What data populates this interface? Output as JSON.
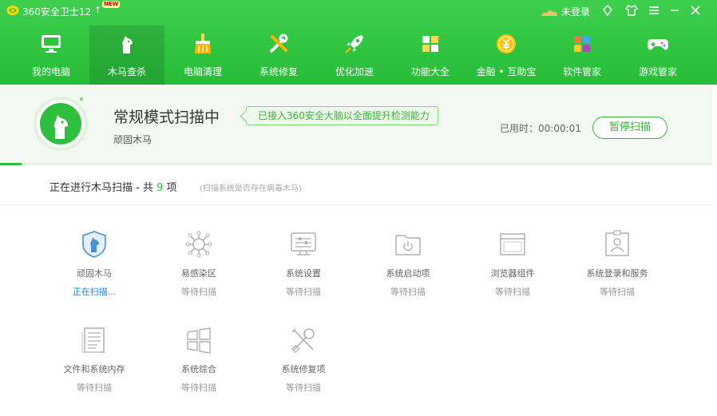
{
  "titlebar": {
    "app_title": "360安全卫士12",
    "new_badge": "NEW",
    "up_arrow": "↑",
    "login_label": "未登录"
  },
  "nav": [
    {
      "label": "我的电脑",
      "icon": "monitor-icon",
      "active": false
    },
    {
      "label": "木马查杀",
      "icon": "horse-icon",
      "active": true
    },
    {
      "label": "电脑清理",
      "icon": "broom-icon",
      "active": false
    },
    {
      "label": "系统修复",
      "icon": "tools-icon",
      "active": false
    },
    {
      "label": "优化加速",
      "icon": "rocket-icon",
      "active": false
    },
    {
      "label": "功能大全",
      "icon": "grid-icon",
      "active": false
    },
    {
      "label": "金融 • 互助宝",
      "icon": "coin-icon",
      "active": false
    },
    {
      "label": "软件管家",
      "icon": "apps-icon",
      "active": false
    },
    {
      "label": "游戏管家",
      "icon": "gamepad-icon",
      "active": false
    }
  ],
  "status": {
    "title": "常规模式扫描中",
    "subtitle": "顽固木马",
    "promo": "已接入360安全大脑以全面提升检测能力",
    "elapsed_label": "已用时：00:00:01",
    "pause_button": "暂停扫描",
    "progress": 0.03
  },
  "scan": {
    "heading_prefix": "正在进行木马扫描 - 共",
    "count": "9",
    "heading_suffix": "项",
    "note": "(扫描系统是否存在病毒木马)"
  },
  "items": [
    {
      "name": "顽固木马",
      "state": "正在扫描...",
      "active": true,
      "icon": "shield-horse-icon"
    },
    {
      "name": "易感染区",
      "state": "等待扫描",
      "active": false,
      "icon": "virus-icon"
    },
    {
      "name": "系统设置",
      "state": "等待扫描",
      "active": false,
      "icon": "monitor-settings-icon"
    },
    {
      "name": "系统启动项",
      "state": "等待扫描",
      "active": false,
      "icon": "startup-folder-icon"
    },
    {
      "name": "浏览器组件",
      "state": "等待扫描",
      "active": false,
      "icon": "browser-window-icon"
    },
    {
      "name": "系统登录和服务",
      "state": "等待扫描",
      "active": false,
      "icon": "id-card-icon"
    },
    {
      "name": "文件和系统内存",
      "state": "等待扫描",
      "active": false,
      "icon": "document-icon"
    },
    {
      "name": "系统综合",
      "state": "等待扫描",
      "active": false,
      "icon": "windows-icon"
    },
    {
      "name": "系统修复项",
      "state": "等待扫描",
      "active": false,
      "icon": "wrench-icon"
    }
  ],
  "colors": {
    "brand_green": "#2fbf3e",
    "scanning_blue": "#1e88e5",
    "icon_gray": "#b0b0b0",
    "icon_blue": "#4a90d9"
  }
}
